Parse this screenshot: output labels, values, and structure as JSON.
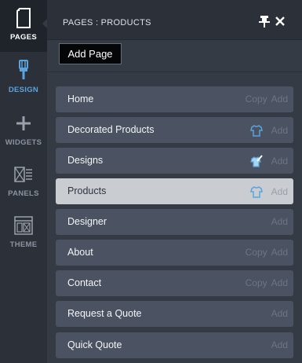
{
  "rail": {
    "items": [
      {
        "label": "PAGES",
        "icon": "page-icon"
      },
      {
        "label": "DESIGN",
        "icon": "brush-icon"
      },
      {
        "label": "WIDGETS",
        "icon": "plus-icon"
      },
      {
        "label": "PANELS",
        "icon": "panels-icon"
      },
      {
        "label": "THEME",
        "icon": "theme-icon"
      }
    ]
  },
  "panel": {
    "title": "PAGES : PRODUCTS",
    "add_page_label": "Add Page",
    "pages": [
      {
        "label": "Home",
        "copy": "Copy",
        "add": "Add",
        "icon": null
      },
      {
        "label": "Decorated Products",
        "copy": null,
        "add": "Add",
        "icon": "shirt-icon"
      },
      {
        "label": "Designs",
        "copy": null,
        "add": "Add",
        "icon": "shirt-brush-icon"
      },
      {
        "label": "Products",
        "copy": null,
        "add": "Add",
        "icon": "shirt-icon",
        "selected": true
      },
      {
        "label": "Designer",
        "copy": null,
        "add": "Add",
        "icon": null
      },
      {
        "label": "About",
        "copy": "Copy",
        "add": "Add",
        "icon": null
      },
      {
        "label": "Contact",
        "copy": "Copy",
        "add": "Add",
        "icon": null
      },
      {
        "label": "Request a Quote",
        "copy": null,
        "add": "Add",
        "icon": null
      },
      {
        "label": "Quick Quote",
        "copy": null,
        "add": "Add",
        "icon": null
      }
    ]
  },
  "colors": {
    "accent": "#5aa3de",
    "row": "#4b5363",
    "row_selected": "#c9ccd1"
  }
}
